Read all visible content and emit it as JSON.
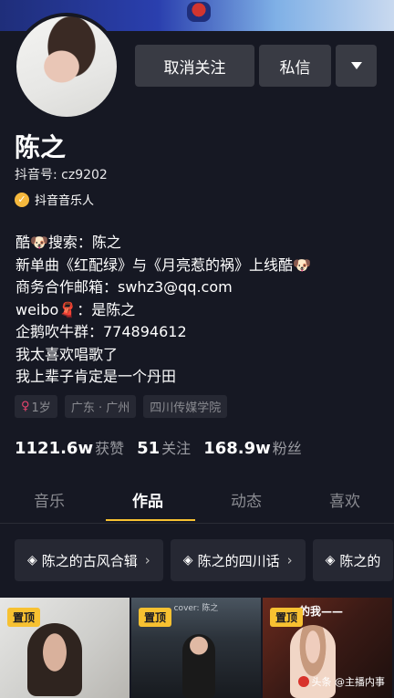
{
  "colors": {
    "background": "#161823",
    "accent": "#f7c131",
    "button": "#393b44",
    "tag_bg": "#262833",
    "muted": "#8a8b91"
  },
  "header": {
    "unfollow_label": "取消关注",
    "message_label": "私信",
    "more_icon": "caret-down-icon"
  },
  "profile": {
    "name": "陈之",
    "douyin_id": "抖音号: cz9202",
    "badge_label": "抖音音乐人",
    "bio": [
      "酷🐶搜索：陈之",
      "新单曲《红配绿》与《月亮惹的祸》上线酷🐶",
      "商务合作邮箱：swhz3@qq.com",
      "weibo🧣：是陈之",
      "企鹅吹牛群：774894612",
      "我太喜欢唱歌了",
      "我上辈子肯定是一个丹田"
    ],
    "tags": [
      "1岁",
      "广东 · 广州",
      "四川传媒学院"
    ]
  },
  "stats": [
    {
      "num": "1121.6w",
      "label": "获赞"
    },
    {
      "num": "51",
      "label": "关注"
    },
    {
      "num": "168.9w",
      "label": "粉丝"
    }
  ],
  "tabs": [
    "音乐",
    "作品",
    "动态",
    "喜欢"
  ],
  "active_tab": "作品",
  "collections": [
    "陈之的古风合辑",
    "陈之的四川话",
    "陈之的"
  ],
  "videos": [
    {
      "pin": "置顶"
    },
    {
      "pin": "置顶",
      "subtitle": "cover: 陈之"
    },
    {
      "pin": "置顶",
      "banner": "的我——"
    }
  ],
  "watermark": "头条 @主播内事"
}
